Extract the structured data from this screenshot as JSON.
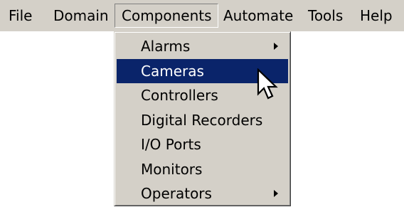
{
  "menubar": {
    "items": [
      {
        "label": "File"
      },
      {
        "label": "Domain"
      },
      {
        "label": "Components"
      },
      {
        "label": "Automate"
      },
      {
        "label": "Tools"
      },
      {
        "label": "Help"
      }
    ]
  },
  "dropdown": {
    "open_menu": "Components",
    "highlighted_item": "Cameras",
    "items": [
      {
        "label": "Alarms",
        "has_submenu": true
      },
      {
        "label": "Cameras",
        "has_submenu": false
      },
      {
        "label": "Controllers",
        "has_submenu": false
      },
      {
        "label": "Digital Recorders",
        "has_submenu": false
      },
      {
        "label": "I/O Ports",
        "has_submenu": false
      },
      {
        "label": "Monitors",
        "has_submenu": false
      },
      {
        "label": "Operators",
        "has_submenu": true
      }
    ]
  },
  "colors": {
    "menu_background": "#d4d0c8",
    "highlight_background": "#0a246a",
    "highlight_text": "#ffffff"
  },
  "icons": {
    "submenu_indicator": "submenu-arrow-icon",
    "pointer": "mouse-pointer-icon"
  }
}
